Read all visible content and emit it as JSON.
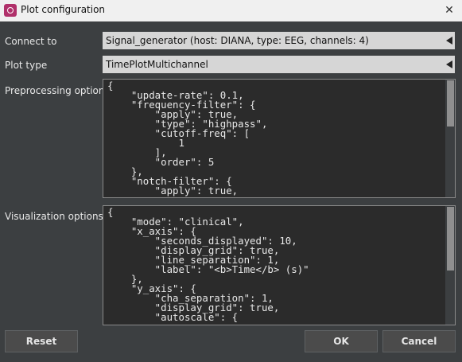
{
  "window": {
    "title": "Plot configuration",
    "icon": "app-logo-icon",
    "close_glyph": "✕"
  },
  "connect": {
    "label": "Connect to",
    "value": "Signal_generator (host: DIANA, type: EEG, channels: 4)"
  },
  "plot_type": {
    "label": "Plot type",
    "value": "TimePlotMultichannel"
  },
  "preprocessing": {
    "label": "Preprocessing options",
    "text": "{\n    \"update-rate\": 0.1,\n    \"frequency-filter\": {\n        \"apply\": true,\n        \"type\": \"highpass\",\n        \"cutoff-freq\": [\n            1\n        ],\n        \"order\": 5\n    },\n    \"notch-filter\": {\n        \"apply\": true,"
  },
  "visualization": {
    "label": "Visualization options",
    "text": "{\n    \"mode\": \"clinical\",\n    \"x_axis\": {\n        \"seconds_displayed\": 10,\n        \"display_grid\": true,\n        \"line_separation\": 1,\n        \"label\": \"<b>Time</b> (s)\"\n    },\n    \"y_axis\": {\n        \"cha_separation\": 1,\n        \"display_grid\": true,\n        \"autoscale\": {"
  },
  "buttons": {
    "reset": "Reset",
    "ok": "OK",
    "cancel": "Cancel"
  },
  "colors": {
    "background": "#3c3f41",
    "combo": "#d6d6d6",
    "editor": "#2b2b2b",
    "accent_icon": "#b0306a"
  }
}
